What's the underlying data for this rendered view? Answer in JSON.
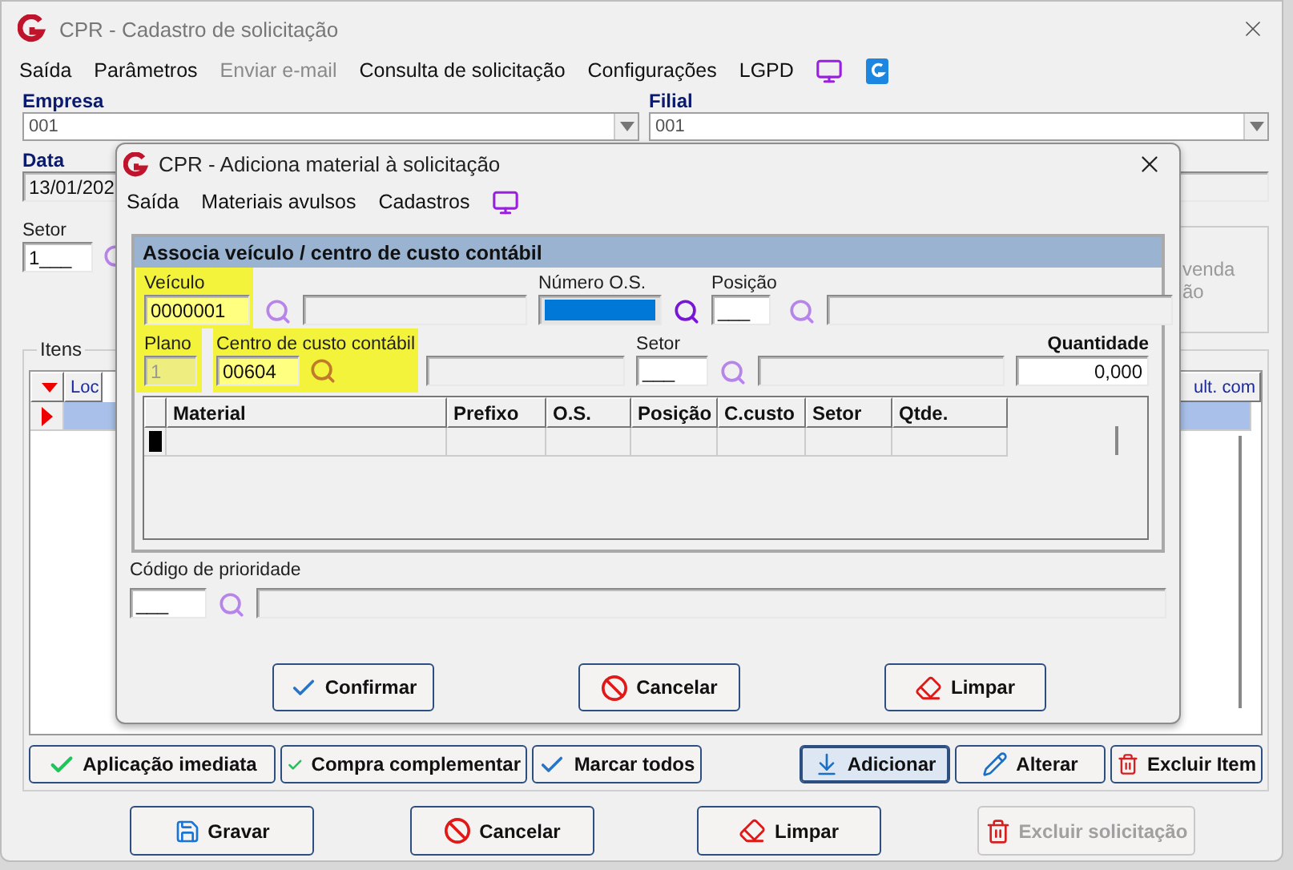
{
  "main_window": {
    "title": "CPR - Cadastro de solicitação",
    "menu": [
      {
        "label": "Saída",
        "disabled": false
      },
      {
        "label": "Parâmetros",
        "disabled": false
      },
      {
        "label": "Enviar e-mail",
        "disabled": true
      },
      {
        "label": "Consulta de solicitação",
        "disabled": false
      },
      {
        "label": "Configurações",
        "disabled": false
      },
      {
        "label": "LGPD",
        "disabled": false
      }
    ],
    "empresa": {
      "label": "Empresa",
      "value": "001"
    },
    "filial": {
      "label": "Filial",
      "value": "001"
    },
    "data": {
      "label": "Data",
      "value": "13/01/202"
    },
    "setor": {
      "label": "Setor",
      "value": "1___"
    },
    "side_text": [
      "venda",
      "ão"
    ],
    "itens": {
      "title": "Itens",
      "columns": [
        "Loc",
        "ult. com"
      ],
      "rows": [
        {
          "selected": true
        }
      ]
    },
    "item_buttons": [
      {
        "label": "Aplicação imediata",
        "kind": "check",
        "focused": false
      },
      {
        "label": "Compra complementar",
        "kind": "check",
        "focused": false
      },
      {
        "label": "Marcar todos",
        "kind": "tick",
        "focused": false
      },
      {
        "label": "Adicionar",
        "kind": "add",
        "focused": true
      },
      {
        "label": "Alterar",
        "kind": "edit",
        "focused": false
      },
      {
        "label": "Excluir Item",
        "kind": "delete",
        "focused": false
      }
    ],
    "buttons": [
      {
        "label": "Gravar",
        "kind": "save",
        "disabled": false
      },
      {
        "label": "Cancelar",
        "kind": "cancel",
        "disabled": false
      },
      {
        "label": "Limpar",
        "kind": "eraser",
        "disabled": false
      },
      {
        "label": "Excluir solicitação",
        "kind": "delete",
        "disabled": true
      }
    ]
  },
  "dialog": {
    "title": "CPR - Adiciona material à solicitação",
    "menu": [
      {
        "label": "Saída"
      },
      {
        "label": "Materiais avulsos"
      },
      {
        "label": "Cadastros"
      }
    ],
    "panel_title": "Associa veículo / centro de custo contábil",
    "veiculo": {
      "label": "Veículo",
      "value": "0000001",
      "highlighted": true
    },
    "numero_os": {
      "label": "Número O.S.",
      "selected": true
    },
    "posicao": {
      "label": "Posição",
      "value": "___"
    },
    "plano": {
      "label": "Plano",
      "value": "1",
      "disabled": true,
      "highlighted": true
    },
    "centro_custo": {
      "label": "Centro de custo contábil",
      "value": "00604",
      "highlighted": true,
      "focused": true
    },
    "setor": {
      "label": "Setor",
      "value": "___"
    },
    "quantidade": {
      "label": "Quantidade",
      "value": "0,000"
    },
    "grid": {
      "columns": [
        "Material",
        "Prefixo",
        "O.S.",
        "Posição",
        "C.custo",
        "Setor",
        "Qtde."
      ],
      "rows": [
        {
          "current": true
        }
      ]
    },
    "prioridade": {
      "label": "Código de prioridade",
      "value": "___"
    },
    "buttons": [
      {
        "label": "Confirmar",
        "kind": "tick"
      },
      {
        "label": "Cancelar",
        "kind": "cancel"
      },
      {
        "label": "Limpar",
        "kind": "eraser"
      }
    ]
  }
}
